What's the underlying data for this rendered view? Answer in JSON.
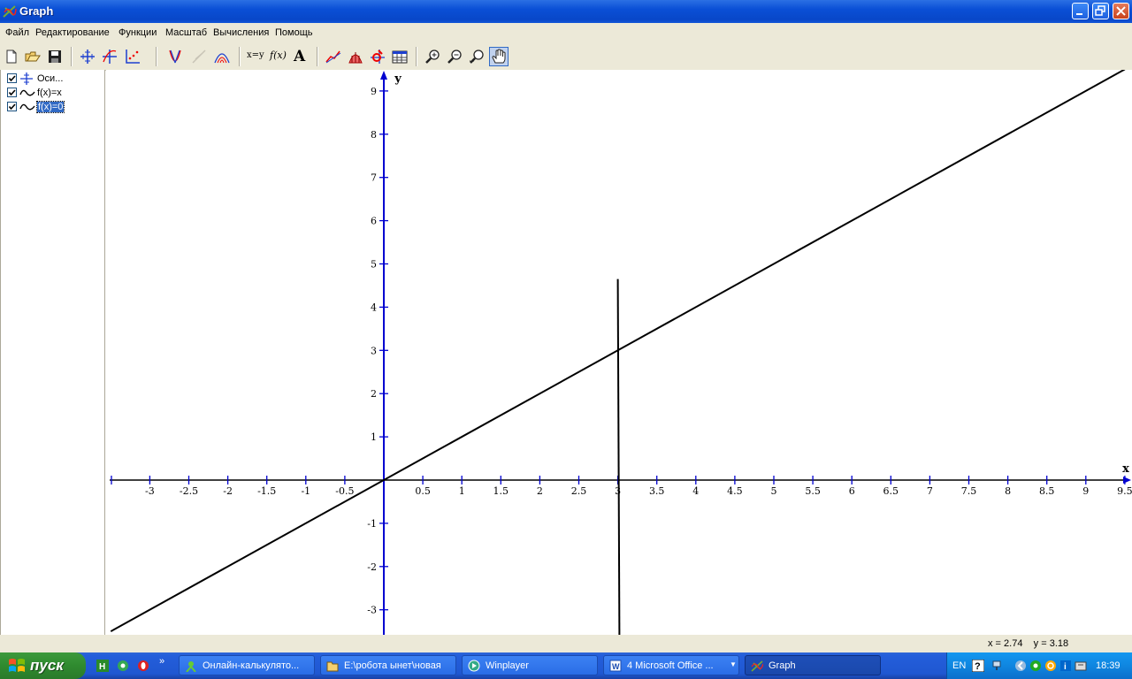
{
  "window": {
    "title": "Graph"
  },
  "menu": [
    "Файл",
    "Редактирование",
    "Функции",
    "Масштаб",
    "Вычисления",
    "Помощь"
  ],
  "toolbar": {
    "groups": [
      [
        "new-icon",
        "open-icon",
        "save-icon"
      ],
      [
        "axes-icon",
        "insert-function-icon",
        "insert-point-series-icon"
      ],
      [
        "tangent-icon",
        "normal-icon",
        "shading-icon"
      ],
      [
        "insert-relation-icon",
        "insert-custom-function-icon",
        "insert-label-icon"
      ],
      [
        "trendline-icon",
        "area-icon",
        "evaluate-icon",
        "table-icon"
      ],
      [
        "zoom-in-icon",
        "zoom-out-icon",
        "zoom-standard-icon",
        "hand-move-icon"
      ]
    ],
    "xy_label": "x=y",
    "fx_label": "f(x)",
    "text_label": "A"
  },
  "tree": [
    {
      "label": "Оси...",
      "checked": true,
      "icon": "axes-icon",
      "selected": false
    },
    {
      "label": "f(x)=x",
      "checked": true,
      "icon": "function-curve-icon",
      "selected": false
    },
    {
      "label": "f(x)=0",
      "checked": true,
      "icon": "function-curve-icon",
      "selected": true
    }
  ],
  "chart_data": {
    "type": "line",
    "xlabel": "x",
    "ylabel": "y",
    "xlim": [
      -3.5,
      9.5
    ],
    "ylim": [
      -3.6,
      9.5
    ],
    "x_ticks": [
      -3,
      -2.5,
      -2,
      -1.5,
      -1,
      -0.5,
      0.5,
      1,
      1.5,
      2,
      2.5,
      3,
      3.5,
      4,
      4.5,
      5,
      5.5,
      6,
      6.5,
      7,
      7.5,
      8,
      8.5,
      9,
      9.5
    ],
    "y_ticks": [
      -3,
      -2,
      -1,
      1,
      2,
      3,
      4,
      5,
      6,
      7,
      8,
      9
    ],
    "series": [
      {
        "name": "f(x)=x",
        "x": [
          -3.5,
          9.5
        ],
        "y": [
          -3.5,
          9.5
        ]
      },
      {
        "x": [
          3,
          3.02
        ],
        "y": [
          4.65,
          -3.6
        ]
      }
    ],
    "colors": {
      "axis": "#0000d0",
      "curve": "#000000",
      "ticklabel": "#000000"
    }
  },
  "status": {
    "coords": "x = 2.74    y = 3.18"
  },
  "taskbar": {
    "start_label": "пуск",
    "tasks": [
      {
        "label": "Онлайн-калькулято...",
        "icon": "calculator-icon",
        "active": false
      },
      {
        "label": "E:\\робота ынет\\новая",
        "icon": "folder-icon",
        "active": false
      },
      {
        "label": "Winplayer",
        "icon": "player-icon",
        "active": false
      },
      {
        "label": "4 Microsoft Office ...",
        "icon": "office-icon",
        "active": false
      },
      {
        "label": "Graph",
        "icon": "graph-app-icon",
        "active": true
      }
    ],
    "tray": {
      "language": "EN",
      "clock": "18:39"
    }
  }
}
